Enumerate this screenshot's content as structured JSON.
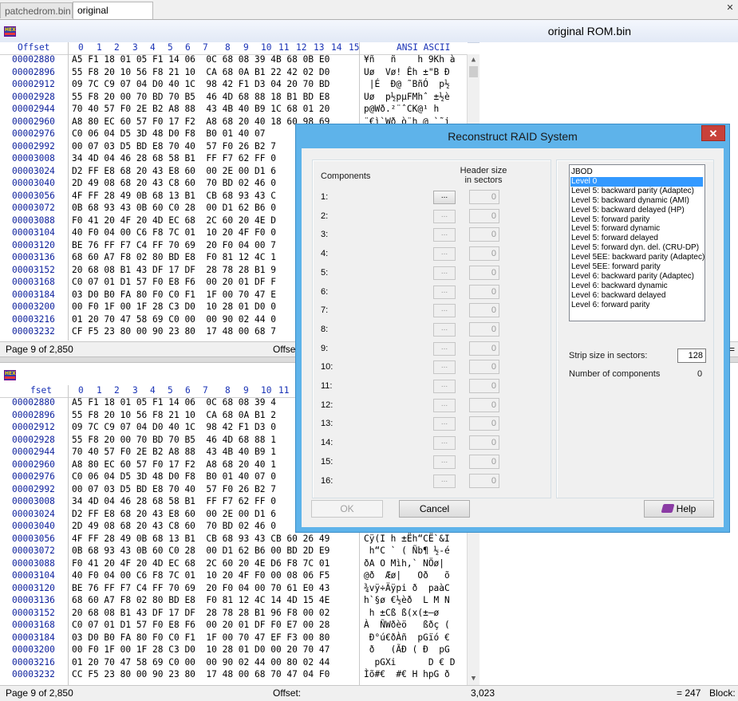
{
  "tabs": [
    {
      "label": "patchedrom.bin",
      "active": false
    },
    {
      "label": "original ROM.bin",
      "active": true
    }
  ],
  "window_controls": {
    "close_label": "✕"
  },
  "pane_title": "original ROM.bin",
  "hex_header": {
    "offset_label": "Offset",
    "columns": [
      "0",
      "1",
      "2",
      "3",
      "4",
      "5",
      "6",
      "7",
      "8",
      "9",
      "10",
      "11",
      "12",
      "13",
      "14",
      "15"
    ],
    "ascii_label": "ANSI ASCII"
  },
  "top_pane": {
    "rows": [
      {
        "offset": "00002880",
        "hex": "A5 F1 18 01 05 F1 14 06  0C 68 08 39 4B 68 0B E0",
        "ascii": "¥ñ   ñ    h 9Kh à"
      },
      {
        "offset": "00002896",
        "hex": "55 F8 20 10 56 F8 21 10  CA 68 0A B1 22 42 02 D0",
        "ascii": "Uø  Vø! Êh ±\"B Ð"
      },
      {
        "offset": "00002912",
        "hex": "09 7C C9 07 04 D0 40 1C  98 42 F1 D3 04 20 70 BD",
        "ascii": " |É  Ð@ ˜BñÓ  p½"
      },
      {
        "offset": "00002928",
        "hex": "55 F8 20 00 70 BD 70 B5  46 4D 68 88 18 B1 BD E8",
        "ascii": "Uø  p½pµFMhˆ ±½è"
      },
      {
        "offset": "00002944",
        "hex": "70 40 57 F0 2E B2 A8 88  43 4B 40 B9 1C 68 01 20",
        "ascii": "p@Wð.²¨ˆCK@¹ h "
      },
      {
        "offset": "00002960",
        "hex": "A8 80 EC 60 57 F0 17 F2  A8 68 20 40 18 60 98 69",
        "ascii": "¨€ì`Wð ò¨h @ `˜i"
      },
      {
        "offset": "00002976",
        "hex": "C0 06 04 D5 3D 48 D0 F8  B0 01 40 07",
        "ascii": ""
      },
      {
        "offset": "00002992",
        "hex": "00 07 03 D5 BD E8 70 40  57 F0 26 B2 7",
        "ascii": ""
      },
      {
        "offset": "00003008",
        "hex": "34 4D 04 46 28 68 58 B1  FF F7 62 FF 0",
        "ascii": ""
      },
      {
        "offset": "00003024",
        "hex": "D2 FF E8 68 20 43 E8 60  00 2E 00 D1 6",
        "ascii": ""
      },
      {
        "offset": "00003040",
        "hex": "2D 49 08 68 20 43 C8 60  70 BD 02 46 0",
        "ascii": ""
      },
      {
        "offset": "00003056",
        "hex": "4F FF 28 49 0B 68 13 B1  CB 68 93 43 C",
        "ascii": ""
      },
      {
        "offset": "00003072",
        "hex": "0B 68 93 43 0B 60 C0 28  00 D1 62 B6 0",
        "ascii": ""
      },
      {
        "offset": "00003088",
        "hex": "F0 41 20 4F 20 4D EC 68  2C 60 20 4E D",
        "ascii": ""
      },
      {
        "offset": "00003104",
        "hex": "40 F0 04 00 C6 F8 7C 01  10 20 4F F0 0",
        "ascii": ""
      },
      {
        "offset": "00003120",
        "hex": "BE 76 FF F7 C4 FF 70 69  20 F0 04 00 7",
        "ascii": ""
      },
      {
        "offset": "00003136",
        "hex": "68 60 A7 F8 02 80 BD E8  F0 81 12 4C 1",
        "ascii": ""
      },
      {
        "offset": "00003152",
        "hex": "20 68 08 B1 43 DF 17 DF  28 78 28 B1 9",
        "ascii": ""
      },
      {
        "offset": "00003168",
        "hex": "C0 07 01 D1 57 F0 E8 F6  00 20 01 DF F",
        "ascii": ""
      },
      {
        "offset": "00003184",
        "hex": "03 D0 B0 FA 80 F0 C0 F1  1F 00 70 47 E",
        "ascii": ""
      },
      {
        "offset": "00003200",
        "hex": "00 F0 1F 00 1F 28 C3 D0  10 28 01 D0 0",
        "ascii": ""
      },
      {
        "offset": "00003216",
        "hex": "01 20 70 47 58 69 C0 00  00 90 02 44 0",
        "ascii": ""
      },
      {
        "offset": "00003232",
        "hex": "CF F5 23 80 00 90 23 80  17 48 00 68 7",
        "ascii": ""
      }
    ],
    "status_page": "Page 9 of 2,850",
    "status_offset": "Offset",
    "status_right": "="
  },
  "bottom_pane": {
    "rows": [
      {
        "offset": "00002880",
        "hex": "A5 F1 18 01 05 F1 14 06  0C 68 08 39 4",
        "ascii": ""
      },
      {
        "offset": "00002896",
        "hex": "55 F8 20 10 56 F8 21 10  CA 68 0A B1 2",
        "ascii": ""
      },
      {
        "offset": "00002912",
        "hex": "09 7C C9 07 04 D0 40 1C  98 42 F1 D3 0",
        "ascii": ""
      },
      {
        "offset": "00002928",
        "hex": "55 F8 20 00 70 BD 70 B5  46 4D 68 88 1",
        "ascii": ""
      },
      {
        "offset": "00002944",
        "hex": "70 40 57 F0 2E B2 A8 88  43 4B 40 B9 1",
        "ascii": ""
      },
      {
        "offset": "00002960",
        "hex": "A8 80 EC 60 57 F0 17 F2  A8 68 20 40 1",
        "ascii": ""
      },
      {
        "offset": "00002976",
        "hex": "C0 06 04 D5 3D 48 D0 F8  B0 01 40 07 0",
        "ascii": ""
      },
      {
        "offset": "00002992",
        "hex": "00 07 03 D5 BD E8 70 40  57 F0 26 B2 7",
        "ascii": ""
      },
      {
        "offset": "00003008",
        "hex": "34 4D 04 46 28 68 58 B1  FF F7 62 FF 0",
        "ascii": ""
      },
      {
        "offset": "00003024",
        "hex": "D2 FF E8 68 20 43 E8 60  00 2E 00 D1 6",
        "ascii": ""
      },
      {
        "offset": "00003040",
        "hex": "2D 49 08 68 20 43 C8 60  70 BD 02 46 0",
        "ascii": ""
      },
      {
        "offset": "00003056",
        "hex": "4F FF 28 49 0B 68 13 B1  CB 68 93 43 CB 60 26 49",
        "ascii": "Cÿ(I h ±Ëh“CË`&I"
      },
      {
        "offset": "00003072",
        "hex": "0B 68 93 43 0B 60 C0 28  00 D1 62 B6 00 BD 2D E9",
        "ascii": " h“C ` ( Ñb¶ ½-é"
      },
      {
        "offset": "00003088",
        "hex": "F0 41 20 4F 20 4D EC 68  2C 60 20 4E D6 F8 7C 01",
        "ascii": "ðA O Mìh,` NÖø|"
      },
      {
        "offset": "00003104",
        "hex": "40 F0 04 00 C6 F8 7C 01  10 20 4F F0 00 08 06 F5",
        "ascii": "@ð  Æø|   Oð   õ"
      },
      {
        "offset": "00003120",
        "hex": "BE 76 FF F7 C4 FF 70 69  20 F0 04 00 70 61 E0 43",
        "ascii": "¾vÿ÷Äÿpi ð  paàC"
      },
      {
        "offset": "00003136",
        "hex": "68 60 A7 F8 02 80 BD E8  F0 81 12 4C 14 4D 15 4E",
        "ascii": "h`§ø €½èð  L M N"
      },
      {
        "offset": "00003152",
        "hex": "20 68 08 B1 43 DF 17 DF  28 78 28 B1 96 F8 00 02",
        "ascii": " h ±Cß ß(x(±–ø  "
      },
      {
        "offset": "00003168",
        "hex": "C0 07 01 D1 57 F0 E8 F6  00 20 01 DF F0 E7 00 28",
        "ascii": "À  ÑWðèö   ßðç ("
      },
      {
        "offset": "00003184",
        "hex": "03 D0 B0 FA 80 F0 C0 F1  1F 00 70 47 EF F3 00 80",
        "ascii": " Ð°ú€ðÀñ  pGïó €"
      },
      {
        "offset": "00003200",
        "hex": "00 F0 1F 00 1F 28 C3 D0  10 28 01 D0 00 20 70 47",
        "ascii": " ð   (ÃÐ ( Ð  pG"
      },
      {
        "offset": "00003216",
        "hex": "01 20 70 47 58 69 C0 00  00 90 02 44 00 80 02 44",
        "ascii": "  pGXi      D € D"
      },
      {
        "offset": "00003232",
        "hex": "CC F5 23 80 00 90 23 80  17 48 00 68 70 47 04 F0",
        "ascii": "Ìõ#€  #€ H hpG ð"
      }
    ],
    "status_page": "Page 9 of 2,850",
    "status_offset": "Offset:",
    "status_offset_value": "3,023",
    "status_right": "= 247",
    "status_block": "Block:"
  },
  "dialog": {
    "title": "Reconstruct RAID System",
    "close_label": "✕",
    "components_label": "Components",
    "header_size_label": "Header size in sectors",
    "browse_label": "...",
    "components": [
      {
        "label": "1:",
        "header": "0"
      },
      {
        "label": "2:",
        "header": "0"
      },
      {
        "label": "3:",
        "header": "0"
      },
      {
        "label": "4:",
        "header": "0"
      },
      {
        "label": "5:",
        "header": "0"
      },
      {
        "label": "6:",
        "header": "0"
      },
      {
        "label": "7:",
        "header": "0"
      },
      {
        "label": "8:",
        "header": "0"
      },
      {
        "label": "9:",
        "header": "0"
      },
      {
        "label": "10:",
        "header": "0"
      },
      {
        "label": "11:",
        "header": "0"
      },
      {
        "label": "12:",
        "header": "0"
      },
      {
        "label": "13:",
        "header": "0"
      },
      {
        "label": "14:",
        "header": "0"
      },
      {
        "label": "15:",
        "header": "0"
      },
      {
        "label": "16:",
        "header": "0"
      }
    ],
    "raid_levels": [
      "JBOD",
      "Level 0",
      "Level 5: backward parity (Adaptec)",
      "Level 5: backward dynamic (AMI)",
      "Level 5: backward delayed (HP)",
      "Level 5: forward parity",
      "Level 5: forward dynamic",
      "Level 5: forward delayed",
      "Level 5: forward dyn. del. (CRU-DP)",
      "Level 5EE: backward parity (Adaptec)",
      "Level 5EE: forward parity",
      "Level 6: backward parity (Adaptec)",
      "Level 6: backward dynamic",
      "Level 6: backward delayed",
      "Level 6: forward parity"
    ],
    "selected_level": "Level 0",
    "strip_size_label": "Strip size in sectors:",
    "strip_size_value": "128",
    "num_components_label": "Number of components",
    "num_components_value": "0",
    "ok_label": "OK",
    "cancel_label": "Cancel",
    "help_label": "Help"
  },
  "colors": {
    "accent": "#5eb3ea",
    "selection": "#3399ff",
    "offset_text": "#0c1f9c"
  }
}
